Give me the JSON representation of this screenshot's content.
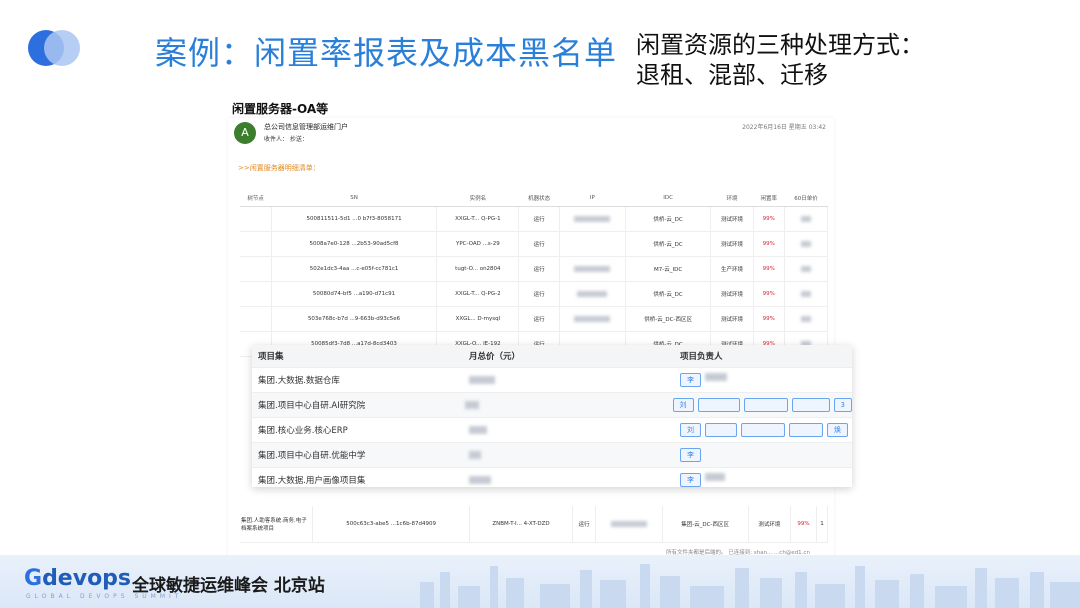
{
  "slide": {
    "title": "案例：闲置率报表及成本黑名单",
    "note_line1": "闲置资源的三种处理方式：",
    "note_line2": "退租、混部、迁移"
  },
  "email": {
    "title": "闲置服务器-OA等",
    "avatar_letter": "A",
    "sender": "总公司信息管理部运维门户",
    "recipients": "收件人：          抄送：",
    "time": "2022年6月16日 星期五 03:42",
    "section": ">>闲置服务器明细清单：",
    "columns": [
      "树节点",
      "SN",
      "实例名",
      "机器状态",
      "IP",
      "IDC",
      "环境",
      "闲置率",
      "60日单价"
    ],
    "rows": [
      {
        "sn": "500811511-5d1 ...0 b7f3-8058171",
        "inst": "XXGL-T... Q-PG-1",
        "status": "运行",
        "idc": "供桥-云_DC",
        "env": "测试环境",
        "rate": "99%"
      },
      {
        "sn": "5008a7e0-128 ...2b53-90ad5cf8",
        "inst": "YPC-OAD ...s-29",
        "status": "运行",
        "idc": "供桥-云_DC",
        "env": "测试环境",
        "rate": "99%"
      },
      {
        "sn": "502e1dc3-4aa ...c-e05f-cc781c1",
        "inst": "tugt-O... on2804",
        "status": "运行",
        "idc": "M7-云_IDC",
        "env": "生产环境",
        "rate": "99%"
      },
      {
        "sn": "50080d74-bf5 ...a190-d71c91",
        "inst": "XXGL-T... Q-PG-2",
        "status": "运行",
        "idc": "供桥-云_DC",
        "env": "测试环境",
        "rate": "99%"
      },
      {
        "sn": "503e768c-b7d ...9-663b-d93c5e6",
        "inst": "XXGL... D-mysql",
        "status": "运行",
        "idc": "供桥-云_DC-西区区",
        "env": "测试环境",
        "rate": "99%"
      },
      {
        "sn": "50085df3-7d8 ...a17d-8cd3403",
        "inst": "XXGL-O... IE-192",
        "status": "运行",
        "idc": "供桥-云_DC",
        "env": "测试环境",
        "rate": "99%"
      }
    ],
    "bottom_row": {
      "node": "集团.人助客系统.商务.电子档案系统项目",
      "sn": "500c63c3-abe5 ...1c6b-87d4909",
      "inst": "ZNBM-T-I... 4-XT-DZD",
      "status": "运行",
      "idc": "集团-云_DC-西区区",
      "env": "测试环境",
      "rate": "99%",
      "price": "1"
    },
    "footer": "所有文件夹都是后端的。  已连接到: shan...  ...ch@ed1.cn"
  },
  "overlay": {
    "col_project": "项目集",
    "col_cost": "月总价（元）",
    "col_owner": "项目负责人",
    "rows": [
      {
        "project": "集团.大数据.数据仓库",
        "owners": [
          "李"
        ]
      },
      {
        "project": "集团.项目中心自研.AI研究院",
        "owners": [
          "刘",
          "",
          "",
          "",
          "3"
        ]
      },
      {
        "project": "集团.核心业务.核心ERP",
        "owners": [
          "刘",
          "",
          "",
          "",
          "焕"
        ]
      },
      {
        "project": "集团.项目中心自研.优能中学",
        "owners": [
          "李"
        ]
      },
      {
        "project": "集团.大数据.用户画像项目集",
        "owners": [
          "李"
        ]
      }
    ]
  },
  "footer": {
    "brand": "devops",
    "brand_initial": "G",
    "brand_cn": "全球敏捷运维峰会 北京站",
    "brand_sub": "GLOBAL DEVOPS SUMMIT"
  },
  "colors": {
    "title_blue": "#2a7fd8",
    "accent_orange": "#e08a1e",
    "rate_red": "#dd2233",
    "tag_blue": "#3b86e6"
  }
}
